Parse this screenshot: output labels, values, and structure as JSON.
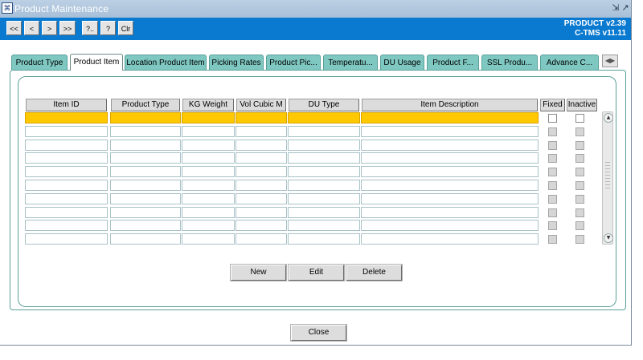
{
  "window": {
    "title": "Product Maintenance",
    "icon": "app-icon"
  },
  "toolbar": {
    "buttons": [
      {
        "label": "<<",
        "icon": "first-record"
      },
      {
        "label": "<",
        "icon": "previous-record"
      },
      {
        "label": ">",
        "icon": "next-record"
      },
      {
        "label": ">>",
        "icon": "last-record"
      },
      {
        "label": "?..",
        "icon": "query"
      },
      {
        "label": "?",
        "icon": "help"
      },
      {
        "label": "Clr",
        "icon": "clear"
      }
    ],
    "version_line1": "PRODUCT v2.39",
    "version_line2": "C-TMS v11.11",
    "background": "#0a7ad0"
  },
  "tabs": [
    {
      "label": "Product Type",
      "active": false
    },
    {
      "label": "Product Item",
      "active": true
    },
    {
      "label": "Location Product Item",
      "active": false
    },
    {
      "label": "Picking Rates",
      "active": false
    },
    {
      "label": "Product Pic...",
      "active": false
    },
    {
      "label": "Temperatu...",
      "active": false
    },
    {
      "label": "DU Usage",
      "active": false
    },
    {
      "label": "Product F...",
      "active": false
    },
    {
      "label": "SSL Produ...",
      "active": false
    },
    {
      "label": "Advance C...",
      "active": false
    }
  ],
  "grid": {
    "columns": [
      "Item ID",
      "Product Type",
      "KG Weight",
      "Vol Cubic M",
      "DU Type",
      "Item Description",
      "Fixed",
      "Inactive"
    ],
    "row_count": 10,
    "selected_row": 0,
    "selected_color": "#ffc800"
  },
  "actions": {
    "new": "New",
    "edit": "Edit",
    "delete": "Delete"
  },
  "footer": {
    "close": "Close"
  },
  "colors": {
    "tab": "#7fc8c2",
    "panel_border": "#5a9f9a"
  }
}
